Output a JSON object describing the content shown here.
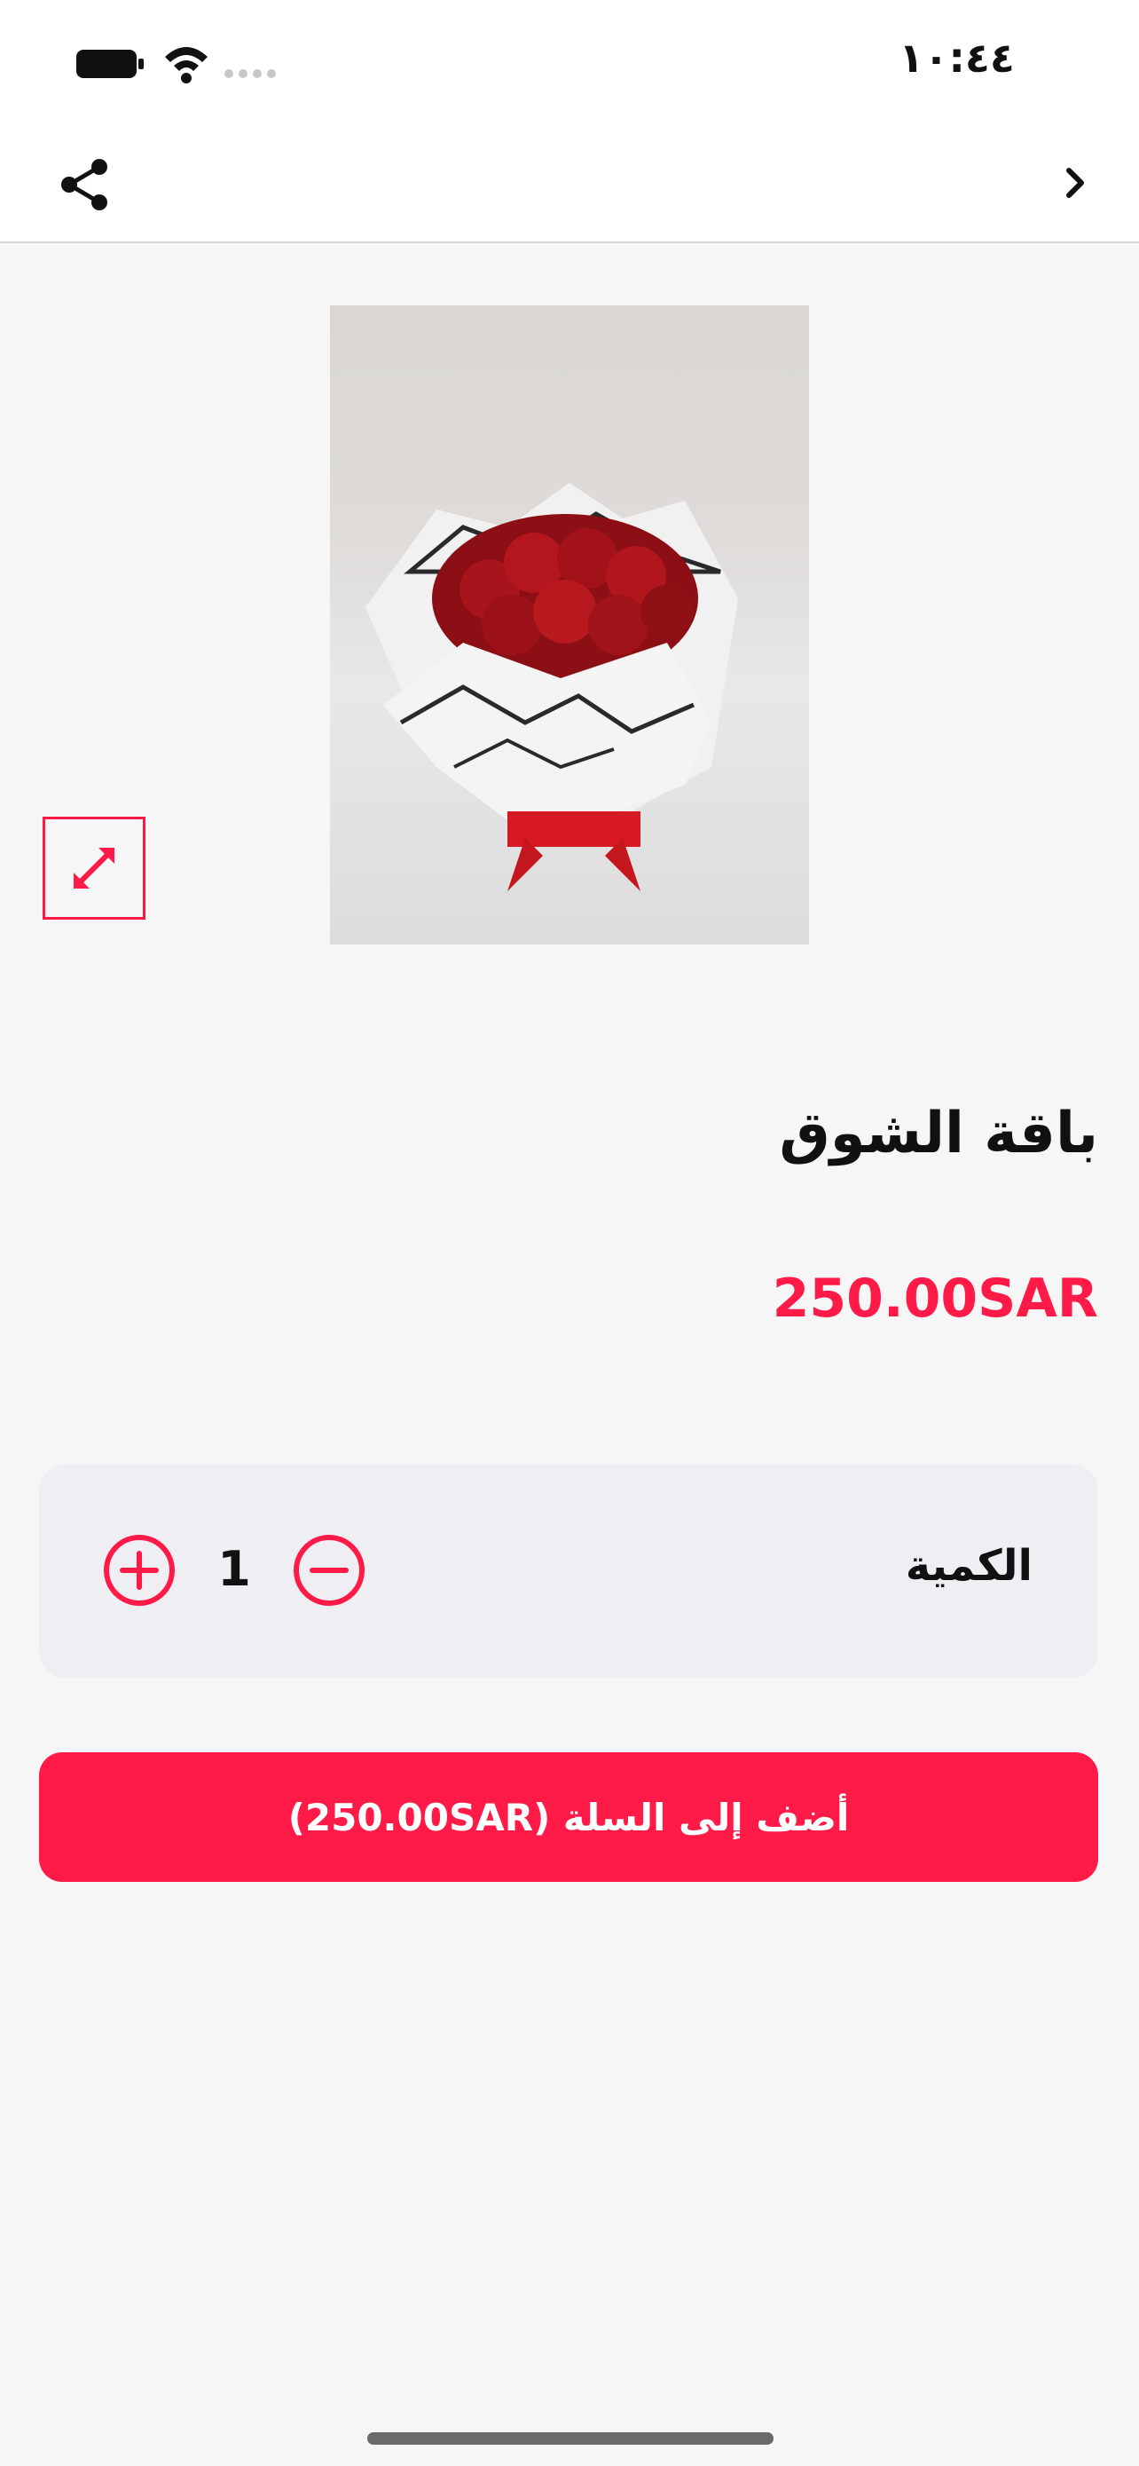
{
  "status_bar": {
    "time": "١٠:٤٤",
    "battery_icon": "battery-icon",
    "wifi_icon": "wifi-icon",
    "signal_icon": "signal-icon"
  },
  "nav": {
    "share_icon": "share-icon",
    "back_icon": "chevron-right-icon"
  },
  "product": {
    "image_icon": "flower-bouquet-image",
    "expand_icon": "expand-icon",
    "title": "باقة الشوق",
    "price": "250.00SAR"
  },
  "quantity": {
    "label": "الكمية",
    "value": "1",
    "increase_icon": "plus-circle-icon",
    "decrease_icon": "minus-circle-icon"
  },
  "cart": {
    "add_label": "أضف إلى السلة (250.00SAR)"
  },
  "colors": {
    "accent": "#ff1a47",
    "background": "#f6f6f6",
    "card": "#efeef3"
  }
}
